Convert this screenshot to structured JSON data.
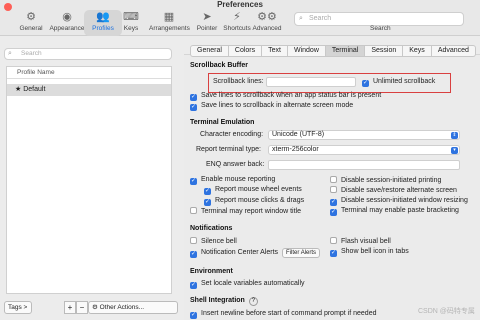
{
  "window": {
    "title": "Preferences"
  },
  "toolbar": {
    "items": [
      {
        "label": "General",
        "icon": "gear-icon"
      },
      {
        "label": "Appearance",
        "icon": "eye-icon"
      },
      {
        "label": "Profiles",
        "icon": "people-icon"
      },
      {
        "label": "Keys",
        "icon": "keyboard-icon"
      },
      {
        "label": "Arrangements",
        "icon": "arrangements-icon"
      },
      {
        "label": "Pointer",
        "icon": "pointer-icon"
      },
      {
        "label": "Shortcuts",
        "icon": "lightning-icon"
      },
      {
        "label": "Advanced",
        "icon": "gears-icon"
      }
    ],
    "active": "Profiles",
    "search": {
      "placeholder": "Search",
      "label": "Search"
    }
  },
  "sidebar": {
    "search_placeholder": "Search",
    "list_header": "Profile Name",
    "profiles": [
      {
        "name": "Default",
        "starred": true
      }
    ],
    "tags_button": "Tags >",
    "add_button": "+",
    "remove_button": "−",
    "other_actions": "Other Actions..."
  },
  "tabs": {
    "items": [
      "General",
      "Colors",
      "Text",
      "Window",
      "Terminal",
      "Session",
      "Keys",
      "Advanced"
    ],
    "active": "Terminal"
  },
  "scrollback": {
    "title": "Scrollback Buffer",
    "lines_label": "Scrollback lines:",
    "lines_value": "",
    "unlimited_label": "Unlimited scrollback",
    "unlimited_checked": true,
    "status_bar_label": "Save lines to scrollback when an app status bar is present",
    "status_bar_checked": true,
    "alt_screen_label": "Save lines to scrollback in alternate screen mode",
    "alt_screen_checked": true
  },
  "emulation": {
    "title": "Terminal Emulation",
    "encoding_label": "Character encoding:",
    "encoding_value": "Unicode (UTF-8)",
    "term_type_label": "Report terminal type:",
    "term_type_value": "xterm-256color",
    "enq_label": "ENQ answer back:",
    "enq_value": "",
    "options": [
      {
        "label": "Enable mouse reporting",
        "checked": true
      },
      {
        "label": "Disable session-initiated printing",
        "checked": false
      },
      {
        "label": "Report mouse wheel events",
        "checked": true
      },
      {
        "label": "Disable save/restore alternate screen",
        "checked": false
      },
      {
        "label": "Report mouse clicks & drags",
        "checked": true
      },
      {
        "label": "Disable session-initiated window resizing",
        "checked": true
      },
      {
        "label": "Terminal may report window title",
        "checked": false
      },
      {
        "label": "Terminal may enable paste bracketing",
        "checked": true
      }
    ]
  },
  "notifications": {
    "title": "Notifications",
    "silence_bell": {
      "label": "Silence bell",
      "checked": false
    },
    "flash_bell": {
      "label": "Flash visual bell",
      "checked": false
    },
    "nc_alerts": {
      "label": "Notification Center Alerts",
      "checked": true
    },
    "filter_button": "Filter Alerts",
    "bell_icon": {
      "label": "Show bell icon in tabs",
      "checked": true
    }
  },
  "environment": {
    "title": "Environment",
    "locale": {
      "label": "Set locale variables automatically",
      "checked": true
    }
  },
  "shell": {
    "title": "Shell Integration",
    "help": "?",
    "newline": {
      "label": "Insert newline before start of command prompt if needed",
      "checked": true
    }
  },
  "watermark": "CSDN @码特专属",
  "colors": {
    "accent": "#2e73e0",
    "highlight_box": "#d94040"
  }
}
